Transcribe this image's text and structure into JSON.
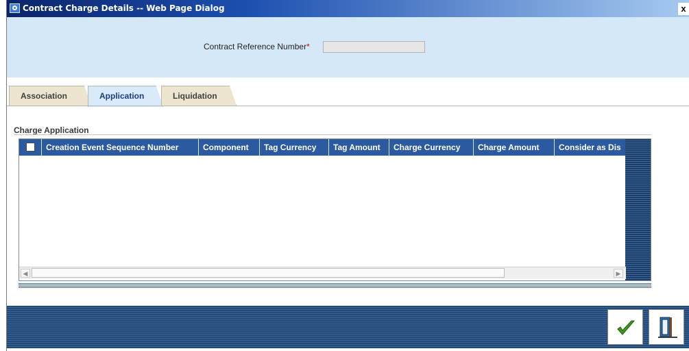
{
  "window": {
    "title": "Contract Charge Details -- Web Page Dialog",
    "close_label": "x",
    "icon": "ie-page-icon"
  },
  "header": {
    "ref_label": "Contract Reference Number",
    "required_marker": "*",
    "ref_value": ""
  },
  "tabs": [
    {
      "label": "Association",
      "active": false
    },
    {
      "label": "Application",
      "active": true
    },
    {
      "label": "Liquidation",
      "active": false
    }
  ],
  "section": {
    "title": "Charge Application"
  },
  "grid": {
    "columns": [
      "Creation Event Sequence Number",
      "Component",
      "Tag Currency",
      "Tag Amount",
      "Charge Currency",
      "Charge Amount",
      "Consider as Dis"
    ],
    "rows": []
  },
  "footer": {
    "ok_icon": "checkmark-icon",
    "exit_icon": "exit-door-icon"
  },
  "colors": {
    "grid_header": "#2c5aa0",
    "header_band": "#d5e8f8",
    "active_tab": "#d9ebfb",
    "inactive_tab": "#ede6cf"
  }
}
